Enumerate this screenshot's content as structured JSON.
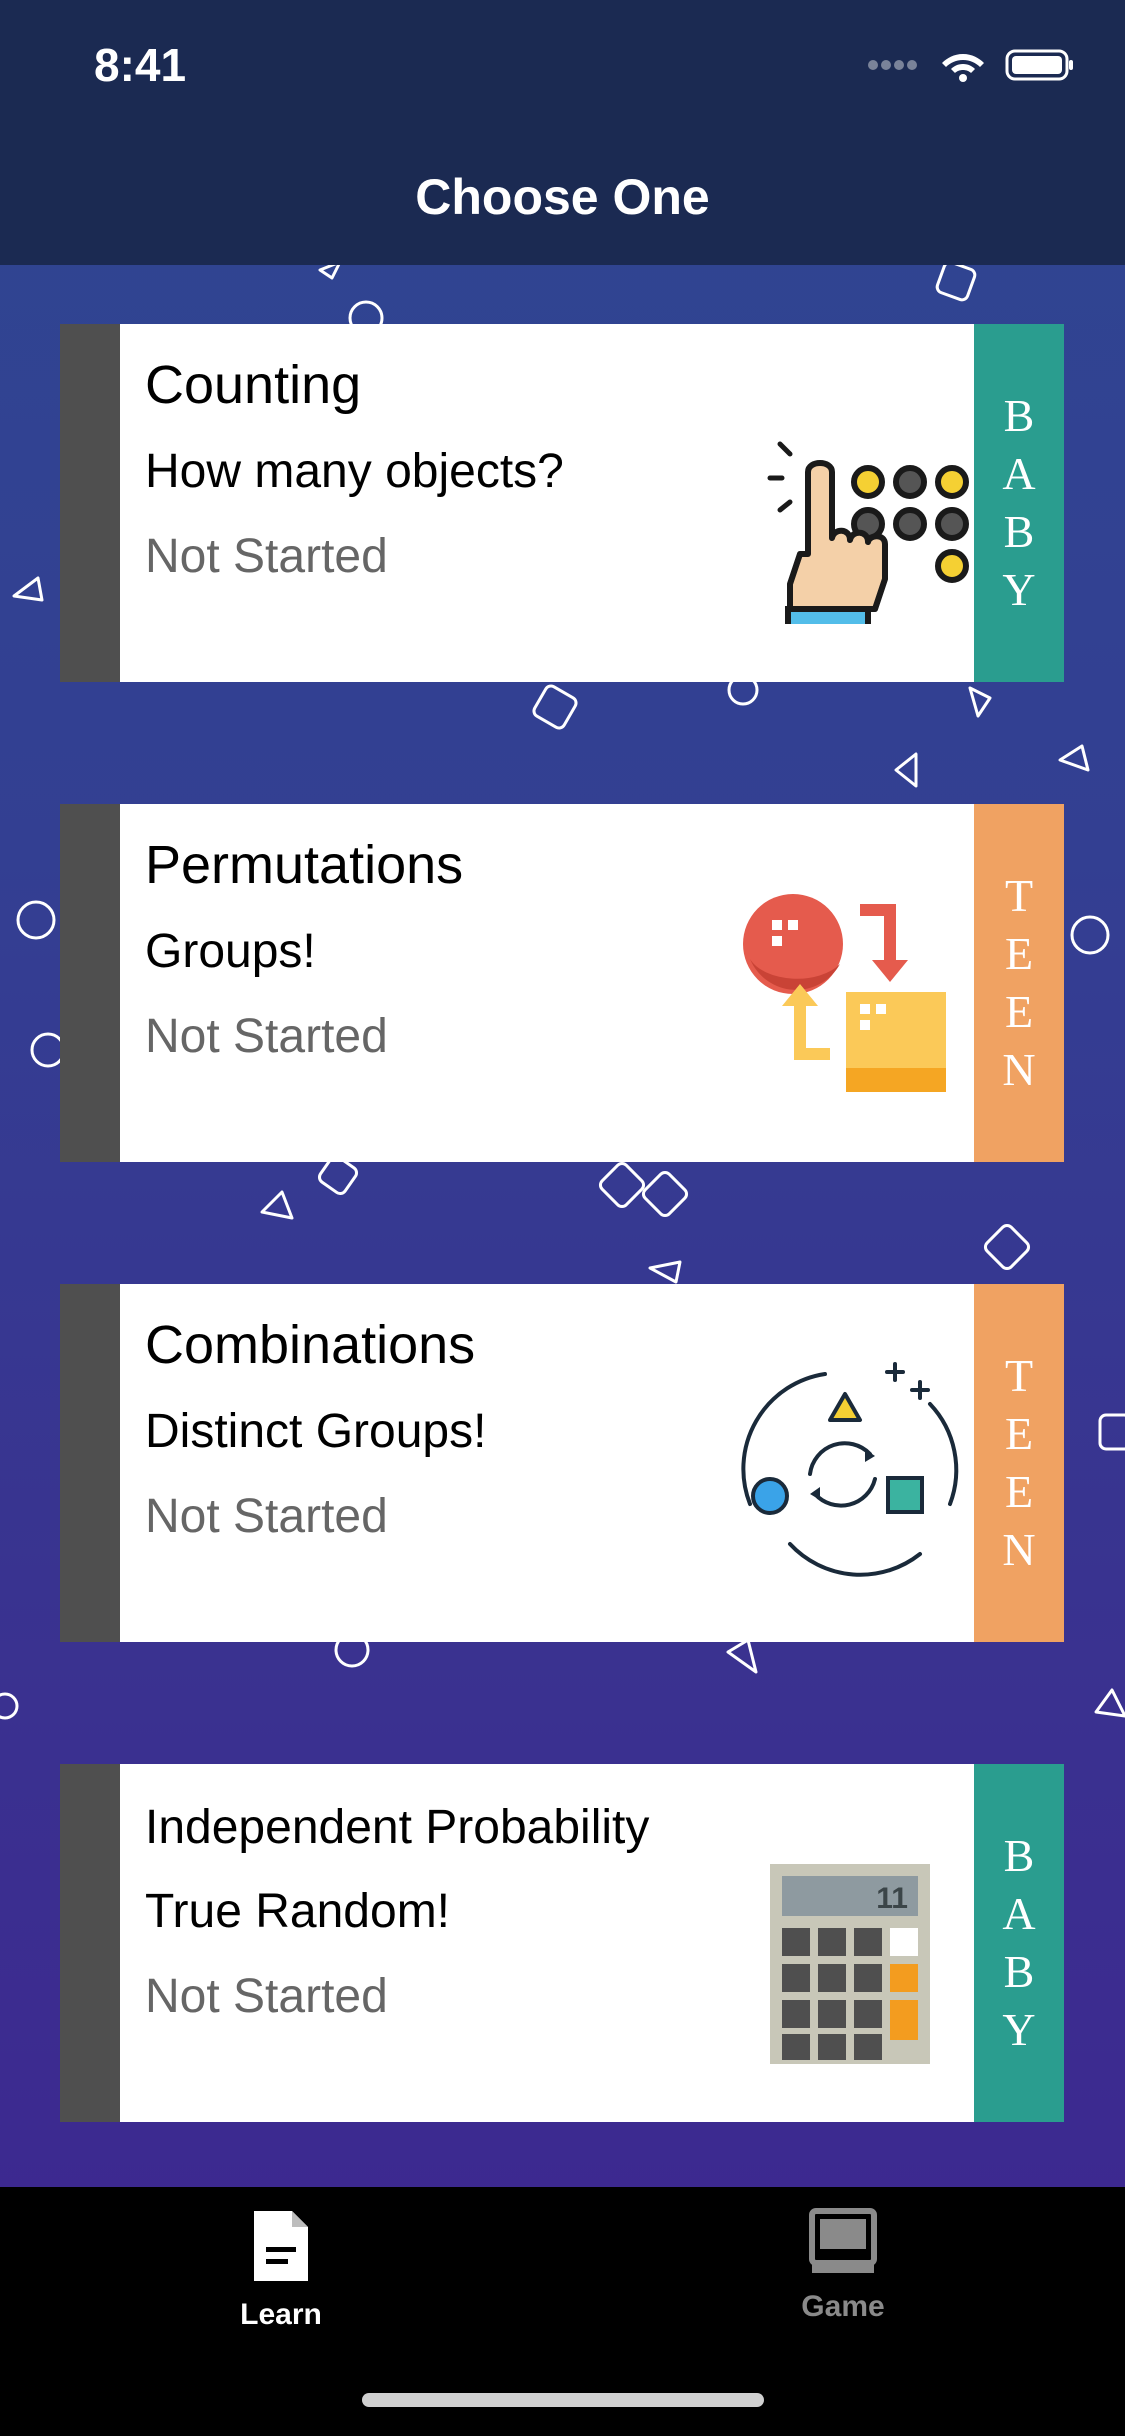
{
  "status_bar": {
    "time": "8:41"
  },
  "nav": {
    "title": "Choose One"
  },
  "cards": [
    {
      "title": "Counting",
      "subtitle": "How many objects?",
      "status": "Not Started",
      "level": "BABY",
      "level_letters": [
        "B",
        "A",
        "B",
        "Y"
      ],
      "level_color": "#2a9d8f",
      "icon": "counting-hand-icon"
    },
    {
      "title": "Permutations",
      "subtitle": "Groups!",
      "status": "Not Started",
      "level": "TEEN",
      "level_letters": [
        "T",
        "E",
        "E",
        "N"
      ],
      "level_color": "#f0a262",
      "icon": "permutation-swap-icon"
    },
    {
      "title": "Combinations",
      "subtitle": "Distinct Groups!",
      "status": "Not Started",
      "level": "TEEN",
      "level_letters": [
        "T",
        "E",
        "E",
        "N"
      ],
      "level_color": "#f0a262",
      "icon": "combination-cycle-icon"
    },
    {
      "title": "Independent Probability",
      "subtitle": "True Random!",
      "status": "Not Started",
      "level": "BABY",
      "level_letters": [
        "B",
        "A",
        "B",
        "Y"
      ],
      "level_color": "#2a9d8f",
      "icon": "calculator-icon",
      "calculator_display": "11"
    }
  ],
  "tabbar": {
    "items": [
      {
        "label": "Learn",
        "icon": "document-icon",
        "active": true
      },
      {
        "label": "Game",
        "icon": "computer-icon",
        "active": false
      }
    ]
  },
  "colors": {
    "header": "#1b2a52",
    "card_strip": "#4f4f4f",
    "tab_active": "#ffffff",
    "tab_inactive": "#8a8a8a"
  }
}
